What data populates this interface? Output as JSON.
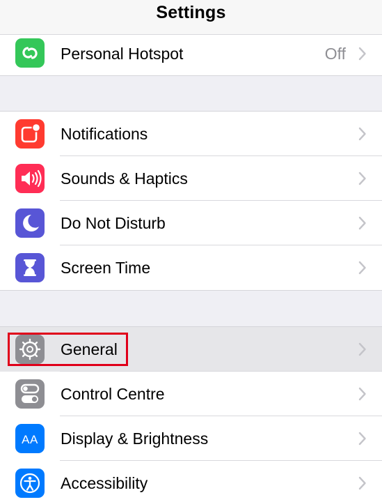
{
  "nav": {
    "title": "Settings"
  },
  "colors": {
    "background": "#efeff4",
    "hotspot": "#34c759",
    "notifications": "#ff3b30",
    "sounds": "#ff2d55",
    "dnd": "#5856d6",
    "screentime": "#5856d6",
    "general": "#8e8e93",
    "control": "#8e8e93",
    "display": "#007aff",
    "accessibility": "#007aff",
    "highlight_box": "#e0001a"
  },
  "groups": [
    {
      "items": [
        {
          "id": "personal-hotspot",
          "label": "Personal Hotspot",
          "value": "Off",
          "icon": "hotspot-icon"
        }
      ]
    },
    {
      "items": [
        {
          "id": "notifications",
          "label": "Notifications",
          "icon": "notifications-icon"
        },
        {
          "id": "sounds-haptics",
          "label": "Sounds & Haptics",
          "icon": "speaker-icon"
        },
        {
          "id": "do-not-disturb",
          "label": "Do Not Disturb",
          "icon": "moon-icon"
        },
        {
          "id": "screen-time",
          "label": "Screen Time",
          "icon": "hourglass-icon"
        }
      ]
    },
    {
      "items": [
        {
          "id": "general",
          "label": "General",
          "icon": "gear-icon",
          "selected": true
        },
        {
          "id": "control-centre",
          "label": "Control Centre",
          "icon": "toggles-icon"
        },
        {
          "id": "display-brightness",
          "label": "Display & Brightness",
          "icon": "text-size-icon"
        },
        {
          "id": "accessibility",
          "label": "Accessibility",
          "icon": "accessibility-icon"
        }
      ]
    }
  ],
  "icon_glyphs": {
    "display": "AA"
  }
}
